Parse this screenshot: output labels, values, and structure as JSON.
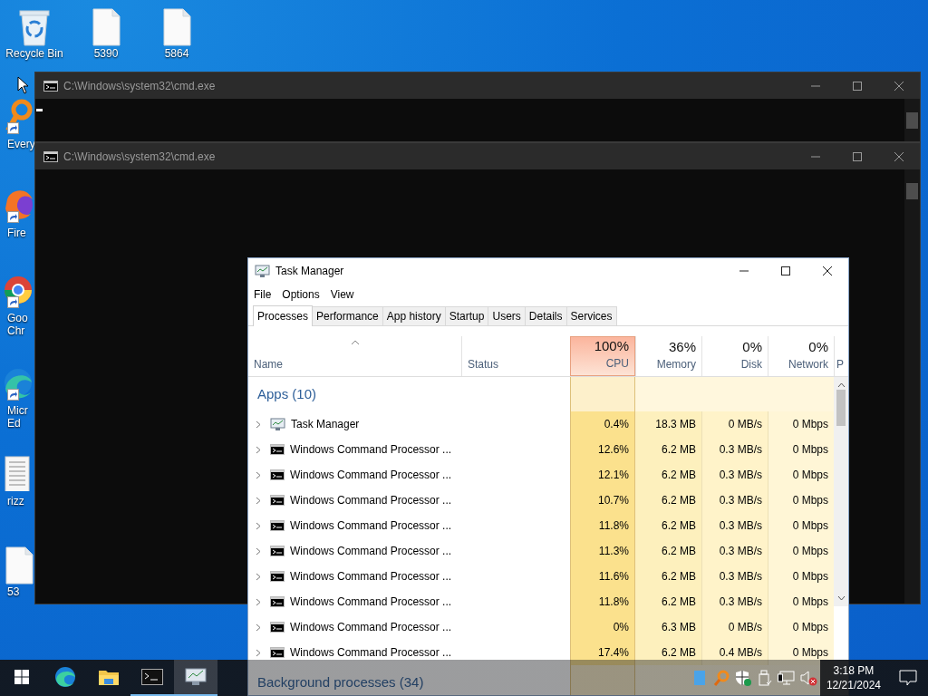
{
  "desktop_icons": [
    {
      "label": "Recycle Bin",
      "kind": "recycle"
    },
    {
      "label": "5390",
      "kind": "file"
    },
    {
      "label": "5864",
      "kind": "file"
    }
  ],
  "side_icons": [
    {
      "lines": [
        "Every"
      ],
      "kind": "magnifier",
      "shortcut": true
    },
    {
      "lines": [
        "Fire"
      ],
      "kind": "fox-globe",
      "shortcut": true
    },
    {
      "lines": [
        "Goo",
        "Chr"
      ],
      "kind": "ring-globe",
      "shortcut": true
    },
    {
      "lines": [
        "Micr",
        "Ed"
      ],
      "kind": "wave-globe",
      "shortcut": true
    },
    {
      "lines": [
        "rizz"
      ],
      "kind": "document",
      "shortcut": false
    },
    {
      "lines": [
        "53"
      ],
      "kind": "file",
      "shortcut": false
    }
  ],
  "cmd_windows": [
    {
      "title": "C:\\Windows\\system32\\cmd.exe",
      "cursor": true
    },
    {
      "title": "C:\\Windows\\system32\\cmd.exe",
      "cursor": false
    }
  ],
  "task_manager": {
    "title": "Task Manager",
    "menu": [
      "File",
      "Options",
      "View"
    ],
    "tabs": [
      {
        "label": "Processes",
        "selected": true
      },
      {
        "label": "Performance",
        "selected": false
      },
      {
        "label": "App history",
        "selected": false
      },
      {
        "label": "Startup",
        "selected": false
      },
      {
        "label": "Users",
        "selected": false
      },
      {
        "label": "Details",
        "selected": false
      },
      {
        "label": "Services",
        "selected": false
      }
    ],
    "columns": [
      {
        "label": "Name",
        "kind": "name",
        "sorted": true
      },
      {
        "label": "Status",
        "kind": "status",
        "sorted": false
      },
      {
        "label": "CPU",
        "usage": "100%",
        "kind": "cpu",
        "sorted": false
      },
      {
        "label": "Memory",
        "usage": "36%",
        "kind": "memory",
        "sorted": false
      },
      {
        "label": "Disk",
        "usage": "0%",
        "kind": "disk",
        "sorted": false
      },
      {
        "label": "Network",
        "usage": "0%",
        "kind": "network",
        "sorted": false
      },
      {
        "label": "P",
        "kind": "cut",
        "sorted": false
      }
    ],
    "groups": [
      {
        "label": "Apps (10)",
        "rows": [
          {
            "name": "Task Manager",
            "kind": "monitor",
            "cpu": "0.4%",
            "memory": "18.3 MB",
            "disk": "0 MB/s",
            "network": "0 Mbps"
          },
          {
            "name": "Windows Command Processor ...",
            "kind": "console",
            "cpu": "12.6%",
            "memory": "6.2 MB",
            "disk": "0.3 MB/s",
            "network": "0 Mbps"
          },
          {
            "name": "Windows Command Processor ...",
            "kind": "console",
            "cpu": "12.1%",
            "memory": "6.2 MB",
            "disk": "0.3 MB/s",
            "network": "0 Mbps"
          },
          {
            "name": "Windows Command Processor ...",
            "kind": "console",
            "cpu": "10.7%",
            "memory": "6.2 MB",
            "disk": "0.3 MB/s",
            "network": "0 Mbps"
          },
          {
            "name": "Windows Command Processor ...",
            "kind": "console",
            "cpu": "11.8%",
            "memory": "6.2 MB",
            "disk": "0.3 MB/s",
            "network": "0 Mbps"
          },
          {
            "name": "Windows Command Processor ...",
            "kind": "console",
            "cpu": "11.3%",
            "memory": "6.2 MB",
            "disk": "0.3 MB/s",
            "network": "0 Mbps"
          },
          {
            "name": "Windows Command Processor ...",
            "kind": "console",
            "cpu": "11.6%",
            "memory": "6.2 MB",
            "disk": "0.3 MB/s",
            "network": "0 Mbps"
          },
          {
            "name": "Windows Command Processor ...",
            "kind": "console",
            "cpu": "11.8%",
            "memory": "6.2 MB",
            "disk": "0.3 MB/s",
            "network": "0 Mbps"
          },
          {
            "name": "Windows Command Processor ...",
            "kind": "console",
            "cpu": "0%",
            "memory": "6.3 MB",
            "disk": "0 MB/s",
            "network": "0 Mbps"
          },
          {
            "name": "Windows Command Processor ...",
            "kind": "console",
            "cpu": "17.4%",
            "memory": "6.2 MB",
            "disk": "0.4 MB/s",
            "network": "0 Mbps"
          }
        ]
      },
      {
        "label": "Background processes (34)"
      }
    ]
  },
  "taskbar": {
    "items": [
      {
        "kind": "start",
        "running": false,
        "selected": false
      },
      {
        "kind": "browser",
        "running": false,
        "selected": false
      },
      {
        "kind": "folder",
        "running": false,
        "selected": false
      },
      {
        "kind": "console",
        "running": true,
        "selected": false
      },
      {
        "kind": "monitor",
        "running": true,
        "selected": true
      }
    ],
    "tray": [
      {
        "kind": "square"
      },
      {
        "kind": "magnifier"
      },
      {
        "kind": "shield"
      },
      {
        "kind": "usb"
      },
      {
        "kind": "network"
      },
      {
        "kind": "speaker-muted"
      }
    ],
    "time": "3:18 PM",
    "date": "12/21/2024"
  }
}
